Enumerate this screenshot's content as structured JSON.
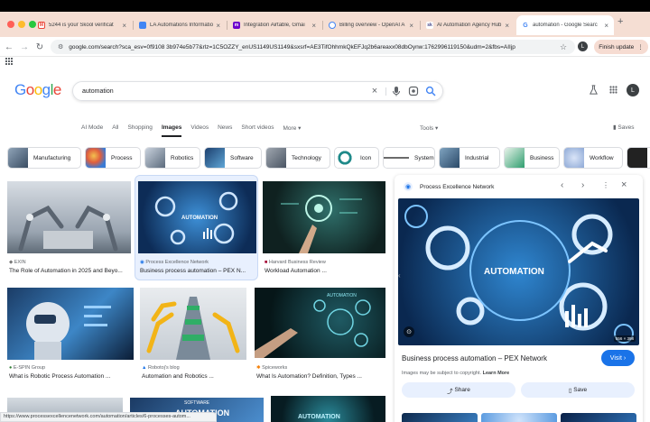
{
  "browser": {
    "tabs": [
      {
        "title": "5244 is your Skool verificat",
        "favicon": "gmail-icon"
      },
      {
        "title": "LA Automations Informatio",
        "favicon": "doc-icon"
      },
      {
        "title": "Integration Airtable, Gmai",
        "favicon": "make-icon"
      },
      {
        "title": "Billing overview - OpenAI A",
        "favicon": "openai-icon"
      },
      {
        "title": "AI Automation Agency Hub",
        "favicon": "skool-icon"
      },
      {
        "title": "automation - Google Searc",
        "favicon": "google-icon"
      }
    ],
    "url": "google.com/search?sca_esv=0f9108 3b974e5b77&rlz=1C5OZZY_enUS1149US1149&sxsrf=AE3TifOhhmkQkEFJq2b6areaxx08dbOynw:1762996119150&udm=2&fbs=AIIjp",
    "finish_update_label": "Finish update",
    "profile_initial": "L"
  },
  "google": {
    "logo_text": "Google",
    "query": "automation",
    "avatar_initial": "L",
    "nav_tabs": [
      "AI Mode",
      "All",
      "Shopping",
      "Images",
      "Videos",
      "News",
      "Short videos",
      "More"
    ],
    "active_tab": "Images",
    "tools_label": "Tools",
    "saves_label": "Saves",
    "chips": [
      "Manufacturing",
      "Process",
      "Robotics",
      "Software",
      "Technology",
      "Icon",
      "System",
      "Industrial",
      "Business",
      "Workflow"
    ]
  },
  "results": [
    {
      "source": "EXIN",
      "title": "The Role of Automation in 2025 and Beyo..."
    },
    {
      "source": "Process Excellence Network",
      "title": "Business process automation – PEX N..."
    },
    {
      "source": "Harvard Business Review",
      "title": "Workload Automation ..."
    },
    {
      "source": "E-SPIN Group",
      "title": "What is Robotic Process Automation ..."
    },
    {
      "source": "Robotoj's blog",
      "title": "Automation and Robotics ..."
    },
    {
      "source": "Spiceworks",
      "title": "What Is Automation? Definition, Types ..."
    }
  ],
  "image_text": {
    "gear_label": "AUTOMATION",
    "software_label": "SOFTWARE",
    "automation_label": "AUTOMATION"
  },
  "panel": {
    "source": "Process Excellence Network",
    "image_text": "AUTOMATION",
    "size": "556 × 398",
    "title": "Business process automation – PEX Network",
    "visit_label": "Visit",
    "copyright": "Images may be subject to copyright.",
    "learn_more": "Learn More",
    "share_label": "Share",
    "save_label": "Save"
  },
  "status_url": "https://www.processexcellencenetwork.com/automation/articles/6-processes-autom...",
  "colors": {
    "accent_blue": "#1a73e8",
    "tab_strip": "#f5ded3"
  }
}
